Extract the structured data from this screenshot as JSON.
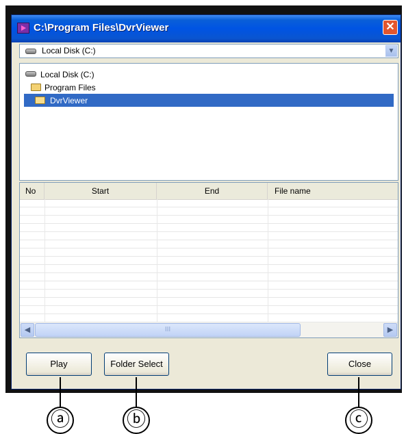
{
  "window": {
    "title": "C:\\Program Files\\DvrViewer",
    "close_glyph": "✕"
  },
  "drive_selector": {
    "value": "Local Disk (C:)",
    "arrow_glyph": "▼"
  },
  "folder_tree": {
    "items": [
      {
        "label": "Local Disk (C:)",
        "icon": "drive-icon",
        "selected": false
      },
      {
        "label": "Program Files",
        "icon": "folder-icon",
        "selected": false
      },
      {
        "label": "DvrViewer",
        "icon": "folder-open-icon",
        "selected": true
      }
    ]
  },
  "file_list": {
    "columns": [
      "No",
      "Start",
      "End",
      "File name"
    ],
    "rows": []
  },
  "scrollbar": {
    "left_glyph": "◀",
    "right_glyph": "▶",
    "grip_glyph": "III"
  },
  "buttons": {
    "play": "Play",
    "folder_select": "Folder Select",
    "close": "Close"
  },
  "callouts": {
    "a": "ⓐ",
    "b": "ⓑ",
    "c": "ⓒ"
  }
}
